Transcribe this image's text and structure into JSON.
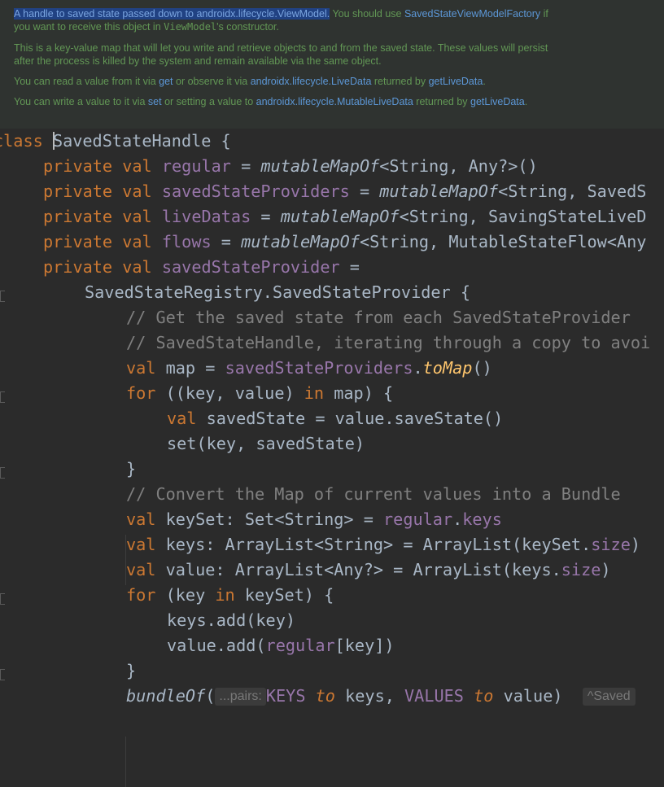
{
  "doc": {
    "p1_selected": "A handle to saved state passed down to androidx.lifecycle.ViewModel.",
    "p1_text1": " You should use ",
    "p1_link": "SavedStateViewModelFactory",
    "p1_text2": " if you want to receive this object in ",
    "p1_code": "ViewModel",
    "p1_text3": "'s constructor.",
    "p2": "This is a key-value map that will let you write and retrieve objects to and from the saved state. These values will persist after the process is killed by the system and remain available via the same object.",
    "p3_a": "You can read a value from it via ",
    "p3_get": "get",
    "p3_b": " or observe it via ",
    "p3_livedata": "androidx.lifecycle.LiveData",
    "p3_c": " returned by ",
    "p3_getlivedata": "getLiveData",
    "p3_d": ".",
    "p4_a": "You can write a value to it via ",
    "p4_set": "set",
    "p4_b": " or setting a value to ",
    "p4_mutable": "androidx.lifecycle.MutableLiveData",
    "p4_c": " returned by ",
    "p4_getlivedata": "getLiveData",
    "p4_d": "."
  },
  "code": {
    "l1": {
      "kw": "class",
      "name": "SavedStateHandle",
      "rest": " {"
    },
    "l2": {
      "kw": "private val ",
      "prop": "regular",
      "op": " = ",
      "fn": "mutableMapOf",
      "rest": "<String, Any?>()"
    },
    "l3": {
      "kw": "private val ",
      "prop": "savedStateProviders",
      "op": " = ",
      "fn": "mutableMapOf",
      "rest": "<String, SavedS"
    },
    "l4": {
      "kw": "private val ",
      "prop": "liveDatas",
      "op": " = ",
      "fn": "mutableMapOf",
      "rest": "<String, SavingStateLiveD"
    },
    "l5": {
      "kw": "private val ",
      "prop": "flows",
      "op": " = ",
      "fn": "mutableMapOf",
      "rest": "<String, MutableStateFlow<Any"
    },
    "l6": {
      "kw": "private val ",
      "prop": "savedStateProvider",
      "rest": " ="
    },
    "l7": {
      "text": "SavedStateRegistry.SavedStateProvider {"
    },
    "l8": {
      "comment": "// Get the saved state from each SavedStateProvider"
    },
    "l9": {
      "comment": "// SavedStateHandle, iterating through a copy to avoi"
    },
    "l10": {
      "kw": "val ",
      "a": "map = ",
      "prop": "savedStateProviders",
      "dot": ".",
      "fn": "toMap",
      "rest": "()"
    },
    "l11": {
      "kw": "for ",
      "a": "((key, value) ",
      "kw2": "in",
      "rest": " map) {"
    },
    "l12": {
      "kw": "val ",
      "rest": "savedState = value.saveState()"
    },
    "l13": {
      "text": "set(key, savedState)"
    },
    "l14": {
      "text": "}"
    },
    "l15": {
      "comment": "// Convert the Map of current values into a Bundle"
    },
    "l16": {
      "kw": "val ",
      "a": "keySet: Set<String> = ",
      "prop": "regular",
      "dot": ".",
      "prop2": "keys"
    },
    "l17": {
      "kw": "val ",
      "a": "keys: ArrayList<String> = ArrayList(keySet.",
      "prop": "size",
      "rest": ")"
    },
    "l18": {
      "kw": "val ",
      "a": "value: ArrayList<Any?> = ArrayList(keys.",
      "prop": "size",
      "rest": ")"
    },
    "l19": {
      "kw": "for ",
      "a": "(key ",
      "kw2": "in",
      "rest": " keySet) {"
    },
    "l20": {
      "text": "keys.add(key)"
    },
    "l21": {
      "a": "value.add(",
      "prop": "regular",
      "rest": "[key])"
    },
    "l22": {
      "text": "}"
    },
    "l23": {
      "fn": "bundleOf",
      "a": "(",
      "hint": "...pairs:",
      "k1": "KEYS",
      "to1": "to",
      "b": " keys, ",
      "k2": "VALUES",
      "to2": "to",
      "c": " value)",
      "hint2": "^Saved"
    }
  }
}
